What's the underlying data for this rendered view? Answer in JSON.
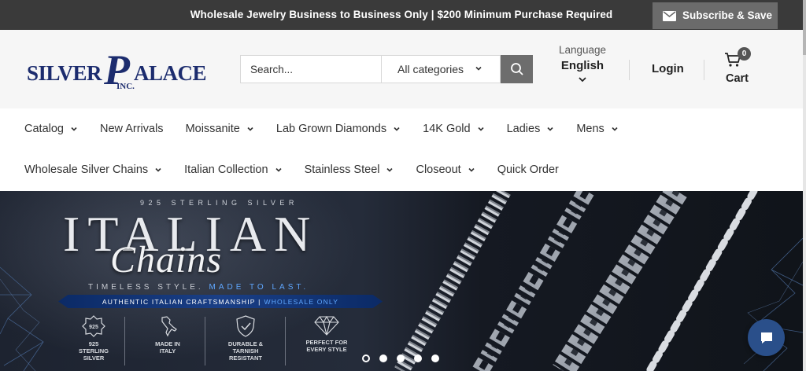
{
  "announcement": {
    "message": "Wholesale Jewelry Business to Business Only | $200 Minimum Purchase Required",
    "subscribe_label": "Subscribe & Save"
  },
  "logo": {
    "left": "SILVER",
    "p": "P",
    "right": "ALACE",
    "inc": "INC."
  },
  "search": {
    "placeholder": "Search...",
    "value": "",
    "category": "All categories"
  },
  "language": {
    "caption": "Language",
    "value": "English"
  },
  "account": {
    "login_label": "Login"
  },
  "cart": {
    "count": "0",
    "label": "Cart"
  },
  "nav": {
    "row1": [
      {
        "label": "Catalog",
        "dropdown": true
      },
      {
        "label": "New Arrivals",
        "dropdown": false
      },
      {
        "label": "Moissanite",
        "dropdown": true
      },
      {
        "label": "Lab Grown Diamonds",
        "dropdown": true
      },
      {
        "label": "14K Gold",
        "dropdown": true
      },
      {
        "label": "Ladies",
        "dropdown": true
      },
      {
        "label": "Mens",
        "dropdown": true
      }
    ],
    "row2": [
      {
        "label": "Wholesale Silver Chains",
        "dropdown": true
      },
      {
        "label": "Italian Collection",
        "dropdown": true
      },
      {
        "label": "Stainless Steel",
        "dropdown": true
      },
      {
        "label": "Closeout",
        "dropdown": true
      },
      {
        "label": "Quick Order",
        "dropdown": false
      }
    ]
  },
  "hero": {
    "subtitle": "925 STERLING SILVER",
    "title": "ITALIAN",
    "script": "Chains",
    "tagline_a": "TIMELESS STYLE.",
    "tagline_b": "MADE TO LAST.",
    "band_a": "AUTHENTIC ITALIAN CRAFTSMANSHIP |",
    "band_b": "WHOLESALE ONLY",
    "badges": [
      {
        "icon": "925-medal-icon",
        "icon_text": "925",
        "line1": "925",
        "line2": "STERLING",
        "line3": "SILVER"
      },
      {
        "icon": "italy-map-icon",
        "line1": "MADE IN",
        "line2": "ITALY",
        "line3": ""
      },
      {
        "icon": "shield-check-icon",
        "line1": "DURABLE &",
        "line2": "TARNISH",
        "line3": "RESISTANT"
      },
      {
        "icon": "diamond-icon",
        "line1": "PERFECT FOR",
        "line2": "EVERY STYLE",
        "line3": ""
      }
    ],
    "slides": 5,
    "active_slide": 1
  },
  "colors": {
    "topbar": "#3a3a3a",
    "header_bg": "#f6f6f6",
    "brand_navy": "#1c2c6e",
    "accent_blue": "#5fa7ff",
    "chat_button": "#2a4f8a"
  }
}
